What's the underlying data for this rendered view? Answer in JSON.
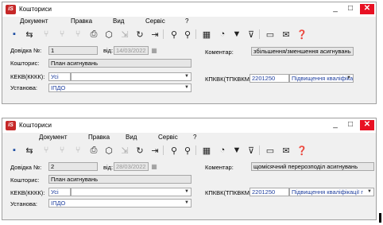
{
  "windows": [
    {
      "title": "Кошториси",
      "menu": [
        "Документ",
        "Правка",
        "Вид",
        "Сервіс",
        "?"
      ],
      "form": {
        "dovidka_label": "Довідка №:",
        "dovidka_value": "1",
        "vid_label": "від:",
        "date_value": "14/03/2022",
        "comment_label": "Коментар:",
        "comment_value": "збільшення/зменшення асигнувань",
        "koshtorys_label": "Кошторис:",
        "koshtorys_value": "План асигнувань",
        "kekv_label": "КЕКВ(КККК):",
        "kekv_value": "Усі",
        "kpkvk_label": "КПКВК(ТПКВКМБ):",
        "kpkvk_code": "2201250",
        "kpkvk_name": "Підвищення кваліфікації г",
        "ustanova_label": "Установа:",
        "ustanova_value": "ІПДО"
      }
    },
    {
      "title": "Кошториси",
      "menu": [
        "Документ",
        "Правка",
        "Вид",
        "Сервіс",
        "?"
      ],
      "form": {
        "dovidka_label": "Довідка №:",
        "dovidka_value": "2",
        "vid_label": "від:",
        "date_value": "28/03/2022",
        "comment_label": "Коментар:",
        "comment_value": "щомісячний перерозподіл асигнувань",
        "koshtorys_label": "Кошторис:",
        "koshtorys_value": "План асигнувань",
        "kekv_label": "КЕКВ(КККК):",
        "kekv_value": "Усі",
        "kpkvk_label": "КПКВК(ТПКВКМБ):",
        "kpkvk_code": "2201250",
        "kpkvk_name": "Підвищення кваліфікації г",
        "ustanova_label": "Установа:",
        "ustanova_value": "ІПДО"
      }
    }
  ],
  "toolbar_icons": [
    "save-icon",
    "chain-icon",
    "branch-disabled-icon",
    "branch-disabled-icon",
    "branch-disabled-icon",
    "print-icon",
    "package-icon",
    "import-disabled-icon",
    "refresh-icon",
    "exit-icon",
    "search-icon",
    "search-next-icon",
    "grid-icon",
    "calendar-icon",
    "filter-icon",
    "filter-clear-icon",
    "document-icon",
    "mail-icon",
    "help-icon"
  ],
  "colors": {
    "close_button": "#e81123",
    "logo": "#c62828",
    "link_text": "#1f3f9f"
  }
}
